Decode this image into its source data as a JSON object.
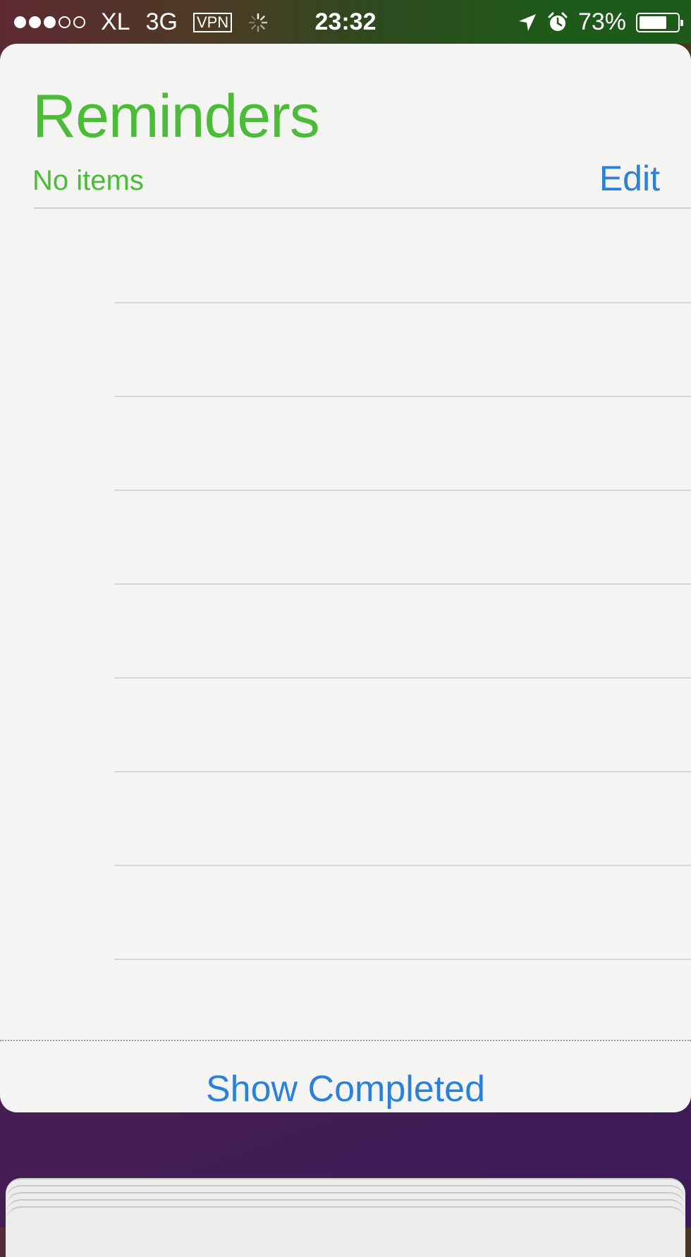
{
  "status_bar": {
    "signal_filled": 3,
    "signal_total": 5,
    "carrier": "XL",
    "network": "3G",
    "vpn": "VPN",
    "time": "23:32",
    "battery_percent_text": "73%",
    "battery_level": 0.73,
    "icons": [
      "activity-spinner-icon",
      "location-arrow-icon",
      "alarm-icon",
      "battery-icon"
    ]
  },
  "reminders": {
    "title": "Reminders",
    "count_label": "No items",
    "edit_label": "Edit",
    "empty_rows": 8,
    "show_completed_label": "Show Completed"
  },
  "colors": {
    "accent_green": "#4cbb38",
    "link_blue": "#2b80d8"
  }
}
